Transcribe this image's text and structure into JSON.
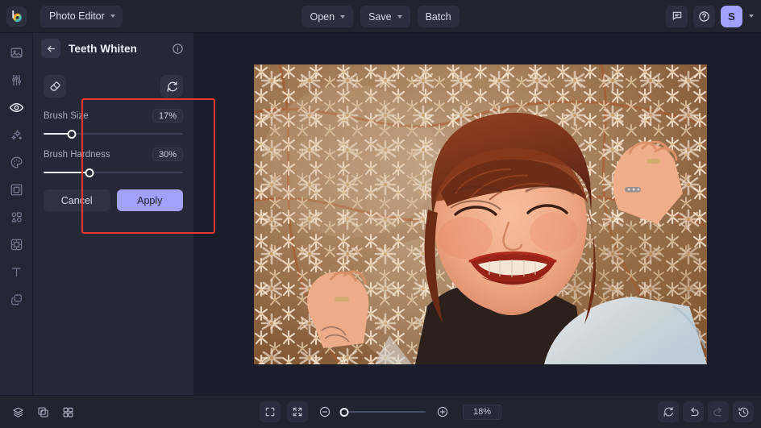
{
  "topbar": {
    "logo_icon": "brand-logo-icon",
    "app_switcher": {
      "label": "Photo Editor",
      "icon": "chevron-down-icon"
    },
    "actions": [
      {
        "label": "Open",
        "icon": "chevron-down-icon",
        "has_caret": true
      },
      {
        "label": "Save",
        "icon": "chevron-down-icon",
        "has_caret": true
      },
      {
        "label": "Batch",
        "has_caret": false
      }
    ],
    "feedback_icon": "chat-bubble-icon",
    "help_icon": "question-circle-icon",
    "avatar_initial": "S",
    "avatar_caret_icon": "chevron-down-icon",
    "avatar_color": "#a3a0fb"
  },
  "sidebar": {
    "items": [
      {
        "name": "image",
        "icon": "image-icon",
        "active": false
      },
      {
        "name": "adjust",
        "icon": "sliders-icon",
        "active": false
      },
      {
        "name": "retouch",
        "icon": "eye-icon",
        "active": true
      },
      {
        "name": "effects",
        "icon": "sparkles-icon",
        "active": false
      },
      {
        "name": "color",
        "icon": "palette-icon",
        "active": false
      },
      {
        "name": "frames",
        "icon": "frame-icon",
        "active": false
      },
      {
        "name": "elements",
        "icon": "shapes-icon",
        "active": false
      },
      {
        "name": "overlays",
        "icon": "overlay-icon",
        "active": false
      },
      {
        "name": "text",
        "icon": "text-t-icon",
        "active": false
      },
      {
        "name": "layers",
        "icon": "stack-layers-icon",
        "active": false
      }
    ]
  },
  "panel": {
    "back_icon": "arrow-left-icon",
    "title": "Teeth Whiten",
    "info_icon": "info-circle-icon",
    "eraser_icon": "eraser-icon",
    "reset_icon": "reset-refresh-icon",
    "sliders": [
      {
        "label": "Brush Size",
        "value": "17%",
        "percent": 20
      },
      {
        "label": "Brush Hardness",
        "value": "30%",
        "percent": 33
      }
    ],
    "cancel_label": "Cancel",
    "apply_label": "Apply",
    "accent_color": "#a3a0fb",
    "annotation_color": "#e8372a"
  },
  "canvas": {
    "photo_alt": "Portrait of smiling woman with red hair lying among white flowers"
  },
  "bottombar": {
    "left_icons": [
      {
        "name": "layers-icon"
      },
      {
        "name": "compare-split-icon"
      },
      {
        "name": "grid-icon"
      }
    ],
    "center": {
      "fullscreen_icon": "expand-fullscreen-icon",
      "fit_screen_icon": "fit-to-screen-icon",
      "zoom_out_icon": "zoom-out-minus-icon",
      "zoom_in_icon": "zoom-in-plus-icon",
      "zoom_percent": "18%",
      "zoom_slider_percent": 3
    },
    "right_icons": [
      {
        "name": "reset-icon",
        "dim": false
      },
      {
        "name": "undo-icon",
        "dim": false
      },
      {
        "name": "redo-icon",
        "dim": true
      },
      {
        "name": "history-icon",
        "dim": false
      }
    ]
  }
}
